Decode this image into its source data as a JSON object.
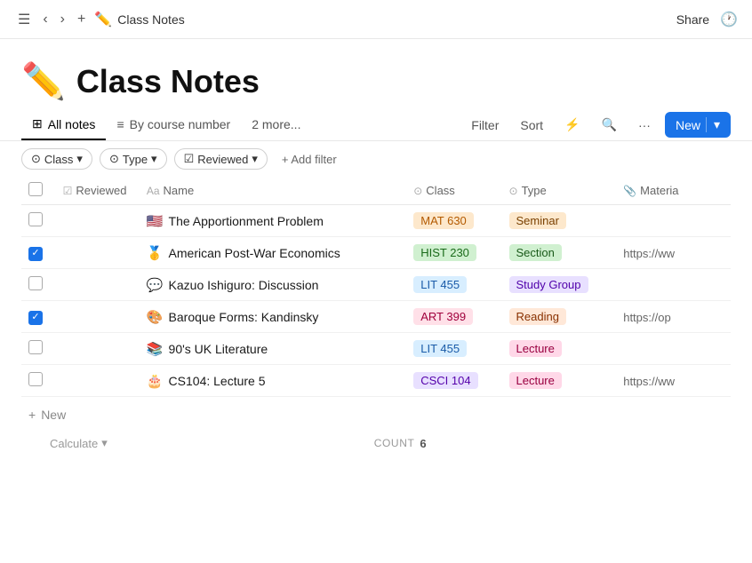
{
  "topbar": {
    "breadcrumb_icon": "✏️",
    "breadcrumb_title": "Class Notes",
    "share_label": "Share",
    "history_icon": "🕐"
  },
  "header": {
    "emoji": "✏️",
    "title": "Class Notes"
  },
  "tabs": [
    {
      "id": "all-notes",
      "label": "All notes",
      "icon": "⊞",
      "active": true
    },
    {
      "id": "by-course",
      "label": "By course number",
      "icon": "≡",
      "active": false
    },
    {
      "id": "more",
      "label": "2 more...",
      "active": false
    }
  ],
  "toolbar": {
    "filter_label": "Filter",
    "sort_label": "Sort",
    "search_icon": "🔍",
    "more_icon": "···",
    "new_label": "New"
  },
  "filters": [
    {
      "id": "class-filter",
      "label": "Class",
      "icon": "⊙"
    },
    {
      "id": "type-filter",
      "label": "Type",
      "icon": "⊙"
    },
    {
      "id": "reviewed-filter",
      "label": "Reviewed",
      "icon": "☑"
    }
  ],
  "add_filter_label": "+ Add filter",
  "columns": [
    {
      "id": "reviewed",
      "label": "Reviewed",
      "icon": "☑"
    },
    {
      "id": "name",
      "label": "Name",
      "icon": "Aa"
    },
    {
      "id": "class",
      "label": "Class",
      "icon": "⊙"
    },
    {
      "id": "type",
      "label": "Type",
      "icon": "⊙"
    },
    {
      "id": "material",
      "label": "Material",
      "icon": "📎"
    }
  ],
  "rows": [
    {
      "id": 1,
      "checked": false,
      "emoji": "🇺🇸",
      "name": "The Apportionment Problem",
      "class": "MAT 630",
      "class_style": "mat",
      "type": "Seminar",
      "type_style": "seminar",
      "material": ""
    },
    {
      "id": 2,
      "checked": true,
      "emoji": "🥇",
      "name": "American Post-War Economics",
      "class": "HIST 230",
      "class_style": "hist",
      "type": "Section",
      "type_style": "section",
      "material": "https://ww"
    },
    {
      "id": 3,
      "checked": false,
      "emoji": "💬",
      "name": "Kazuo Ishiguro: Discussion",
      "class": "LIT 455",
      "class_style": "lit",
      "type": "Study Group",
      "type_style": "studygroup",
      "material": ""
    },
    {
      "id": 4,
      "checked": true,
      "emoji": "🎨",
      "name": "Baroque Forms: Kandinsky",
      "class": "ART 399",
      "class_style": "art",
      "type": "Reading",
      "type_style": "reading",
      "material": "https://op"
    },
    {
      "id": 5,
      "checked": false,
      "emoji": "📚",
      "name": "90's UK Literature",
      "class": "LIT 455",
      "class_style": "lit",
      "type": "Lecture",
      "type_style": "lecture",
      "material": ""
    },
    {
      "id": 6,
      "checked": false,
      "emoji": "🎂",
      "name": "CS104: Lecture 5",
      "class": "CSCI 104",
      "class_style": "csci",
      "type": "Lecture",
      "type_style": "lecture",
      "material": "https://ww"
    }
  ],
  "footer": {
    "new_label": "New",
    "calculate_label": "Calculate",
    "count_label": "COUNT",
    "count_value": "6"
  }
}
